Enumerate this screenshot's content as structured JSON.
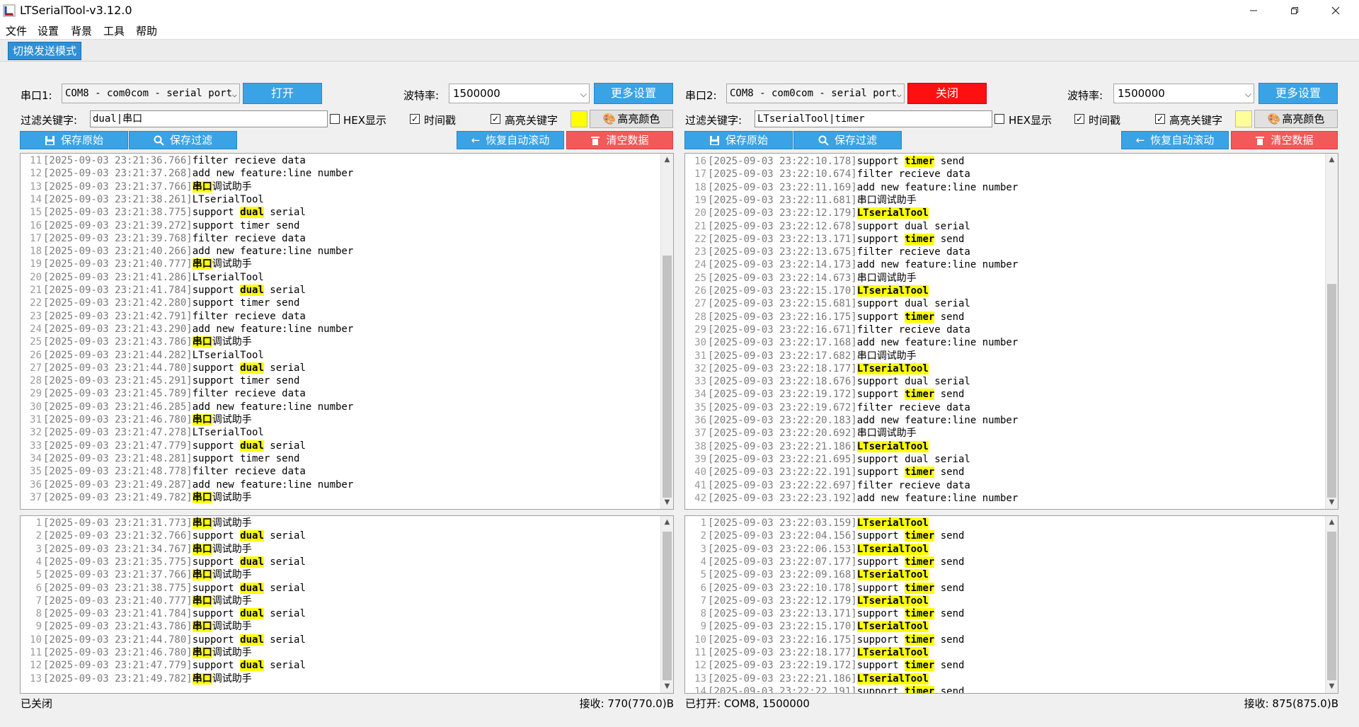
{
  "window": {
    "title": "LTSerialTool-v3.12.0"
  },
  "menu": [
    "文件",
    "设置",
    "背景",
    "工具",
    "帮助"
  ],
  "toolbar": {
    "mode_button": "切换发送模式"
  },
  "left": {
    "port_label": "串口1:",
    "port_value": "COM8 - com0com - serial port",
    "open_button": "打开",
    "baud_label": "波特率:",
    "baud_value": "1500000",
    "more_button": "更多设置",
    "filter_label": "过滤关键字:",
    "filter_value": "dual|串口",
    "hex_label": "HEX显示",
    "hex_checked": false,
    "timestamp_label": "时间戳",
    "timestamp_checked": true,
    "highlight_label": "高亮关键字",
    "highlight_checked": true,
    "swatch_color": "#ffff00",
    "color_button": "高亮颜色",
    "save_raw_button": "保存原始",
    "save_filter_button": "保存过滤",
    "autoscroll_button": "恢复自动滚动",
    "clear_button": "清空数据",
    "status": "已关闭",
    "rx": "接收: 770(770.0)B",
    "log_top": [
      {
        "n": "11",
        "ts": "[2025-09-03 23:21:36.766]",
        "parts": [
          [
            "filter recieve data",
            false
          ]
        ]
      },
      {
        "n": "12",
        "ts": "[2025-09-03 23:21:37.268]",
        "parts": [
          [
            "add new feature:line number",
            false
          ]
        ]
      },
      {
        "n": "13",
        "ts": "[2025-09-03 23:21:37.766]",
        "parts": [
          [
            "串口",
            true
          ],
          [
            "调试助手",
            false
          ]
        ]
      },
      {
        "n": "14",
        "ts": "[2025-09-03 23:21:38.261]",
        "parts": [
          [
            "LTserialTool",
            false
          ]
        ]
      },
      {
        "n": "15",
        "ts": "[2025-09-03 23:21:38.775]",
        "parts": [
          [
            "support ",
            false
          ],
          [
            "dual",
            true
          ],
          [
            " serial",
            false
          ]
        ]
      },
      {
        "n": "16",
        "ts": "[2025-09-03 23:21:39.272]",
        "parts": [
          [
            "support timer send",
            false
          ]
        ]
      },
      {
        "n": "17",
        "ts": "[2025-09-03 23:21:39.768]",
        "parts": [
          [
            "filter recieve data",
            false
          ]
        ]
      },
      {
        "n": "18",
        "ts": "[2025-09-03 23:21:40.266]",
        "parts": [
          [
            "add new feature:line number",
            false
          ]
        ]
      },
      {
        "n": "19",
        "ts": "[2025-09-03 23:21:40.777]",
        "parts": [
          [
            "串口",
            true
          ],
          [
            "调试助手",
            false
          ]
        ]
      },
      {
        "n": "20",
        "ts": "[2025-09-03 23:21:41.286]",
        "parts": [
          [
            "LTserialTool",
            false
          ]
        ]
      },
      {
        "n": "21",
        "ts": "[2025-09-03 23:21:41.784]",
        "parts": [
          [
            "support ",
            false
          ],
          [
            "dual",
            true
          ],
          [
            " serial",
            false
          ]
        ]
      },
      {
        "n": "22",
        "ts": "[2025-09-03 23:21:42.280]",
        "parts": [
          [
            "support timer send",
            false
          ]
        ]
      },
      {
        "n": "23",
        "ts": "[2025-09-03 23:21:42.791]",
        "parts": [
          [
            "filter recieve data",
            false
          ]
        ]
      },
      {
        "n": "24",
        "ts": "[2025-09-03 23:21:43.290]",
        "parts": [
          [
            "add new feature:line number",
            false
          ]
        ]
      },
      {
        "n": "25",
        "ts": "[2025-09-03 23:21:43.786]",
        "parts": [
          [
            "串口",
            true
          ],
          [
            "调试助手",
            false
          ]
        ]
      },
      {
        "n": "26",
        "ts": "[2025-09-03 23:21:44.282]",
        "parts": [
          [
            "LTserialTool",
            false
          ]
        ]
      },
      {
        "n": "27",
        "ts": "[2025-09-03 23:21:44.780]",
        "parts": [
          [
            "support ",
            false
          ],
          [
            "dual",
            true
          ],
          [
            " serial",
            false
          ]
        ]
      },
      {
        "n": "28",
        "ts": "[2025-09-03 23:21:45.291]",
        "parts": [
          [
            "support timer send",
            false
          ]
        ]
      },
      {
        "n": "29",
        "ts": "[2025-09-03 23:21:45.789]",
        "parts": [
          [
            "filter recieve data",
            false
          ]
        ]
      },
      {
        "n": "30",
        "ts": "[2025-09-03 23:21:46.285]",
        "parts": [
          [
            "add new feature:line number",
            false
          ]
        ]
      },
      {
        "n": "31",
        "ts": "[2025-09-03 23:21:46.780]",
        "parts": [
          [
            "串口",
            true
          ],
          [
            "调试助手",
            false
          ]
        ]
      },
      {
        "n": "32",
        "ts": "[2025-09-03 23:21:47.278]",
        "parts": [
          [
            "LTserialTool",
            false
          ]
        ]
      },
      {
        "n": "33",
        "ts": "[2025-09-03 23:21:47.779]",
        "parts": [
          [
            "support ",
            false
          ],
          [
            "dual",
            true
          ],
          [
            " serial",
            false
          ]
        ]
      },
      {
        "n": "34",
        "ts": "[2025-09-03 23:21:48.281]",
        "parts": [
          [
            "support timer send",
            false
          ]
        ]
      },
      {
        "n": "35",
        "ts": "[2025-09-03 23:21:48.778]",
        "parts": [
          [
            "filter recieve data",
            false
          ]
        ]
      },
      {
        "n": "36",
        "ts": "[2025-09-03 23:21:49.287]",
        "parts": [
          [
            "add new feature:line number",
            false
          ]
        ]
      },
      {
        "n": "37",
        "ts": "[2025-09-03 23:21:49.782]",
        "parts": [
          [
            "串口",
            true
          ],
          [
            "调试助手",
            false
          ]
        ]
      }
    ],
    "log_bottom": [
      {
        "n": "1",
        "ts": "[2025-09-03 23:21:31.773]",
        "parts": [
          [
            "串口",
            true
          ],
          [
            "调试助手",
            false
          ]
        ]
      },
      {
        "n": "2",
        "ts": "[2025-09-03 23:21:32.766]",
        "parts": [
          [
            "support ",
            false
          ],
          [
            "dual",
            true
          ],
          [
            " serial",
            false
          ]
        ]
      },
      {
        "n": "3",
        "ts": "[2025-09-03 23:21:34.767]",
        "parts": [
          [
            "串口",
            true
          ],
          [
            "调试助手",
            false
          ]
        ]
      },
      {
        "n": "4",
        "ts": "[2025-09-03 23:21:35.775]",
        "parts": [
          [
            "support ",
            false
          ],
          [
            "dual",
            true
          ],
          [
            " serial",
            false
          ]
        ]
      },
      {
        "n": "5",
        "ts": "[2025-09-03 23:21:37.766]",
        "parts": [
          [
            "串口",
            true
          ],
          [
            "调试助手",
            false
          ]
        ]
      },
      {
        "n": "6",
        "ts": "[2025-09-03 23:21:38.775]",
        "parts": [
          [
            "support ",
            false
          ],
          [
            "dual",
            true
          ],
          [
            " serial",
            false
          ]
        ]
      },
      {
        "n": "7",
        "ts": "[2025-09-03 23:21:40.777]",
        "parts": [
          [
            "串口",
            true
          ],
          [
            "调试助手",
            false
          ]
        ]
      },
      {
        "n": "8",
        "ts": "[2025-09-03 23:21:41.784]",
        "parts": [
          [
            "support ",
            false
          ],
          [
            "dual",
            true
          ],
          [
            " serial",
            false
          ]
        ]
      },
      {
        "n": "9",
        "ts": "[2025-09-03 23:21:43.786]",
        "parts": [
          [
            "串口",
            true
          ],
          [
            "调试助手",
            false
          ]
        ]
      },
      {
        "n": "10",
        "ts": "[2025-09-03 23:21:44.780]",
        "parts": [
          [
            "support ",
            false
          ],
          [
            "dual",
            true
          ],
          [
            " serial",
            false
          ]
        ]
      },
      {
        "n": "11",
        "ts": "[2025-09-03 23:21:46.780]",
        "parts": [
          [
            "串口",
            true
          ],
          [
            "调试助手",
            false
          ]
        ]
      },
      {
        "n": "12",
        "ts": "[2025-09-03 23:21:47.779]",
        "parts": [
          [
            "support ",
            false
          ],
          [
            "dual",
            true
          ],
          [
            " serial",
            false
          ]
        ]
      },
      {
        "n": "13",
        "ts": "[2025-09-03 23:21:49.782]",
        "parts": [
          [
            "串口",
            true
          ],
          [
            "调试助手",
            false
          ]
        ]
      }
    ]
  },
  "right": {
    "port_label": "串口2:",
    "port_value": "COM8 - com0com - serial port",
    "close_button": "关闭",
    "baud_label": "波特率:",
    "baud_value": "1500000",
    "more_button": "更多设置",
    "filter_label": "过滤关键字:",
    "filter_value": "LTserialTool|timer",
    "hex_label": "HEX显示",
    "hex_checked": false,
    "timestamp_label": "时间戳",
    "timestamp_checked": true,
    "highlight_label": "高亮关键字",
    "highlight_checked": true,
    "swatch_color": "#ffff99",
    "color_button": "高亮颜色",
    "save_raw_button": "保存原始",
    "save_filter_button": "保存过滤",
    "autoscroll_button": "恢复自动滚动",
    "clear_button": "清空数据",
    "status": "已打开: COM8, 1500000",
    "rx": "接收: 875(875.0)B",
    "log_top": [
      {
        "n": "16",
        "ts": "[2025-09-03 23:22:10.178]",
        "parts": [
          [
            "support ",
            false
          ],
          [
            "timer",
            true
          ],
          [
            " send",
            false
          ]
        ]
      },
      {
        "n": "17",
        "ts": "[2025-09-03 23:22:10.674]",
        "parts": [
          [
            "filter recieve data",
            false
          ]
        ]
      },
      {
        "n": "18",
        "ts": "[2025-09-03 23:22:11.169]",
        "parts": [
          [
            "add new feature:line number",
            false
          ]
        ]
      },
      {
        "n": "19",
        "ts": "[2025-09-03 23:22:11.681]",
        "parts": [
          [
            "串口调试助手",
            false
          ]
        ]
      },
      {
        "n": "20",
        "ts": "[2025-09-03 23:22:12.179]",
        "parts": [
          [
            "LTserialTool",
            true
          ]
        ]
      },
      {
        "n": "21",
        "ts": "[2025-09-03 23:22:12.678]",
        "parts": [
          [
            "support dual serial",
            false
          ]
        ]
      },
      {
        "n": "22",
        "ts": "[2025-09-03 23:22:13.171]",
        "parts": [
          [
            "support ",
            false
          ],
          [
            "timer",
            true
          ],
          [
            " send",
            false
          ]
        ]
      },
      {
        "n": "23",
        "ts": "[2025-09-03 23:22:13.675]",
        "parts": [
          [
            "filter recieve data",
            false
          ]
        ]
      },
      {
        "n": "24",
        "ts": "[2025-09-03 23:22:14.173]",
        "parts": [
          [
            "add new feature:line number",
            false
          ]
        ]
      },
      {
        "n": "25",
        "ts": "[2025-09-03 23:22:14.673]",
        "parts": [
          [
            "串口调试助手",
            false
          ]
        ]
      },
      {
        "n": "26",
        "ts": "[2025-09-03 23:22:15.170]",
        "parts": [
          [
            "LTserialTool",
            true
          ]
        ]
      },
      {
        "n": "27",
        "ts": "[2025-09-03 23:22:15.681]",
        "parts": [
          [
            "support dual serial",
            false
          ]
        ]
      },
      {
        "n": "28",
        "ts": "[2025-09-03 23:22:16.175]",
        "parts": [
          [
            "support ",
            false
          ],
          [
            "timer",
            true
          ],
          [
            " send",
            false
          ]
        ]
      },
      {
        "n": "29",
        "ts": "[2025-09-03 23:22:16.671]",
        "parts": [
          [
            "filter recieve data",
            false
          ]
        ]
      },
      {
        "n": "30",
        "ts": "[2025-09-03 23:22:17.168]",
        "parts": [
          [
            "add new feature:line number",
            false
          ]
        ]
      },
      {
        "n": "31",
        "ts": "[2025-09-03 23:22:17.682]",
        "parts": [
          [
            "串口调试助手",
            false
          ]
        ]
      },
      {
        "n": "32",
        "ts": "[2025-09-03 23:22:18.177]",
        "parts": [
          [
            "LTserialTool",
            true
          ]
        ]
      },
      {
        "n": "33",
        "ts": "[2025-09-03 23:22:18.676]",
        "parts": [
          [
            "support dual serial",
            false
          ]
        ]
      },
      {
        "n": "34",
        "ts": "[2025-09-03 23:22:19.172]",
        "parts": [
          [
            "support ",
            false
          ],
          [
            "timer",
            true
          ],
          [
            " send",
            false
          ]
        ]
      },
      {
        "n": "35",
        "ts": "[2025-09-03 23:22:19.672]",
        "parts": [
          [
            "filter recieve data",
            false
          ]
        ]
      },
      {
        "n": "36",
        "ts": "[2025-09-03 23:22:20.183]",
        "parts": [
          [
            "add new feature:line number",
            false
          ]
        ]
      },
      {
        "n": "37",
        "ts": "[2025-09-03 23:22:20.692]",
        "parts": [
          [
            "串口调试助手",
            false
          ]
        ]
      },
      {
        "n": "38",
        "ts": "[2025-09-03 23:22:21.186]",
        "parts": [
          [
            "LTserialTool",
            true
          ]
        ]
      },
      {
        "n": "39",
        "ts": "[2025-09-03 23:22:21.695]",
        "parts": [
          [
            "support dual serial",
            false
          ]
        ]
      },
      {
        "n": "40",
        "ts": "[2025-09-03 23:22:22.191]",
        "parts": [
          [
            "support ",
            false
          ],
          [
            "timer",
            true
          ],
          [
            " send",
            false
          ]
        ]
      },
      {
        "n": "41",
        "ts": "[2025-09-03 23:22:22.697]",
        "parts": [
          [
            "filter recieve data",
            false
          ]
        ]
      },
      {
        "n": "42",
        "ts": "[2025-09-03 23:22:23.192]",
        "parts": [
          [
            "add new feature:line number",
            false
          ]
        ]
      }
    ],
    "log_bottom": [
      {
        "n": "1",
        "ts": "[2025-09-03 23:22:03.159]",
        "parts": [
          [
            "LTserialTool",
            true
          ]
        ]
      },
      {
        "n": "2",
        "ts": "[2025-09-03 23:22:04.156]",
        "parts": [
          [
            "support ",
            false
          ],
          [
            "timer",
            true
          ],
          [
            " send",
            false
          ]
        ]
      },
      {
        "n": "3",
        "ts": "[2025-09-03 23:22:06.153]",
        "parts": [
          [
            "LTserialTool",
            true
          ]
        ]
      },
      {
        "n": "4",
        "ts": "[2025-09-03 23:22:07.177]",
        "parts": [
          [
            "support ",
            false
          ],
          [
            "timer",
            true
          ],
          [
            " send",
            false
          ]
        ]
      },
      {
        "n": "5",
        "ts": "[2025-09-03 23:22:09.168]",
        "parts": [
          [
            "LTserialTool",
            true
          ]
        ]
      },
      {
        "n": "6",
        "ts": "[2025-09-03 23:22:10.178]",
        "parts": [
          [
            "support ",
            false
          ],
          [
            "timer",
            true
          ],
          [
            " send",
            false
          ]
        ]
      },
      {
        "n": "7",
        "ts": "[2025-09-03 23:22:12.179]",
        "parts": [
          [
            "LTserialTool",
            true
          ]
        ]
      },
      {
        "n": "8",
        "ts": "[2025-09-03 23:22:13.171]",
        "parts": [
          [
            "support ",
            false
          ],
          [
            "timer",
            true
          ],
          [
            " send",
            false
          ]
        ]
      },
      {
        "n": "9",
        "ts": "[2025-09-03 23:22:15.170]",
        "parts": [
          [
            "LTserialTool",
            true
          ]
        ]
      },
      {
        "n": "10",
        "ts": "[2025-09-03 23:22:16.175]",
        "parts": [
          [
            "support ",
            false
          ],
          [
            "timer",
            true
          ],
          [
            " send",
            false
          ]
        ]
      },
      {
        "n": "11",
        "ts": "[2025-09-03 23:22:18.177]",
        "parts": [
          [
            "LTserialTool",
            true
          ]
        ]
      },
      {
        "n": "12",
        "ts": "[2025-09-03 23:22:19.172]",
        "parts": [
          [
            "support ",
            false
          ],
          [
            "timer",
            true
          ],
          [
            " send",
            false
          ]
        ]
      },
      {
        "n": "13",
        "ts": "[2025-09-03 23:22:21.186]",
        "parts": [
          [
            "LTserialTool",
            true
          ]
        ]
      },
      {
        "n": "14",
        "ts": "[2025-09-03 23:22:22.191]",
        "parts": [
          [
            "support ",
            false
          ],
          [
            "timer",
            true
          ],
          [
            " send",
            false
          ]
        ]
      }
    ]
  },
  "colors": {
    "button_blue": "#39a3e6",
    "close_red": "#ff1010",
    "clear_red": "#f25a5a",
    "highlight": "#ffff00"
  }
}
